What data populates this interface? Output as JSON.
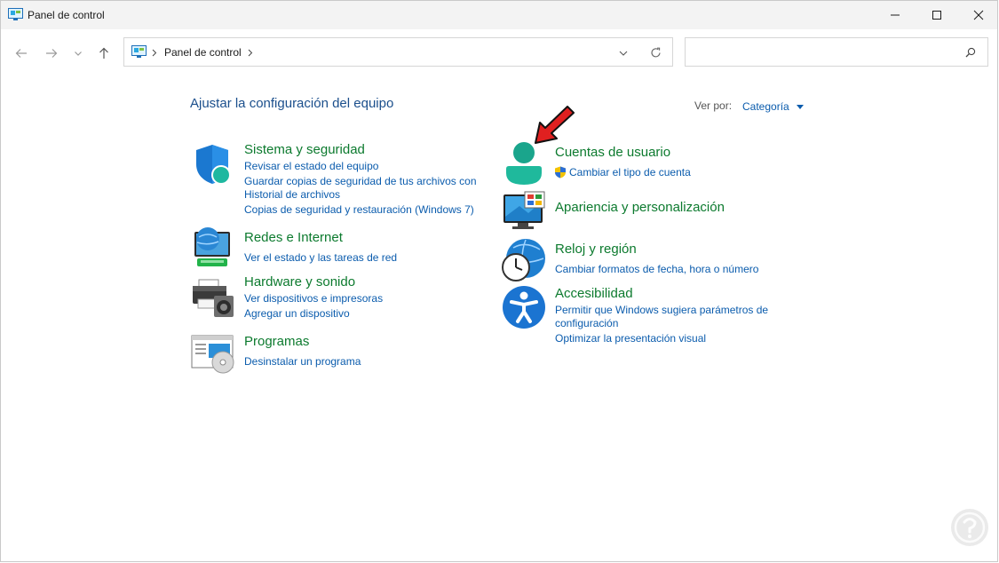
{
  "window": {
    "title": "Panel de control"
  },
  "address_bar": {
    "breadcrumb": [
      "Panel de control"
    ],
    "search_placeholder": ""
  },
  "main": {
    "heading": "Ajustar la configuración del equipo",
    "view_by_label": "Ver por:",
    "view_by_value": "Categoría"
  },
  "categories": [
    {
      "title": "Sistema y seguridad",
      "links": [
        "Revisar el estado del equipo",
        "Guardar copias de seguridad de tus archivos con",
        "Historial de archivos",
        "Copias de seguridad y restauración (Windows 7)"
      ],
      "icon": "shield-icon"
    },
    {
      "title": "Redes e Internet",
      "links": [
        "Ver el estado y las tareas de red"
      ],
      "icon": "network-icon"
    },
    {
      "title": "Hardware y sonido",
      "links": [
        "Ver dispositivos e impresoras",
        "Agregar un dispositivo"
      ],
      "icon": "printer-icon"
    },
    {
      "title": "Programas",
      "links": [
        "Desinstalar un programa"
      ],
      "icon": "programs-icon"
    },
    {
      "title": "Cuentas de usuario",
      "links": [
        "Cambiar el tipo de cuenta"
      ],
      "icon": "user-icon"
    },
    {
      "title": "Apariencia y personalización",
      "links": [],
      "icon": "monitor-icon"
    },
    {
      "title": "Reloj y región",
      "links": [
        "Cambiar formatos de fecha, hora o número"
      ],
      "icon": "clock-globe-icon"
    },
    {
      "title": "Accesibilidad",
      "links": [
        "Permitir que Windows sugiera parámetros de",
        "configuración",
        "Optimizar la presentación visual"
      ],
      "icon": "accessibility-icon"
    }
  ],
  "colors": {
    "category_title": "#0c7a2e",
    "link": "#0b5cad",
    "heading": "#1b4f8c",
    "annotation_arrow": "#e02020"
  }
}
